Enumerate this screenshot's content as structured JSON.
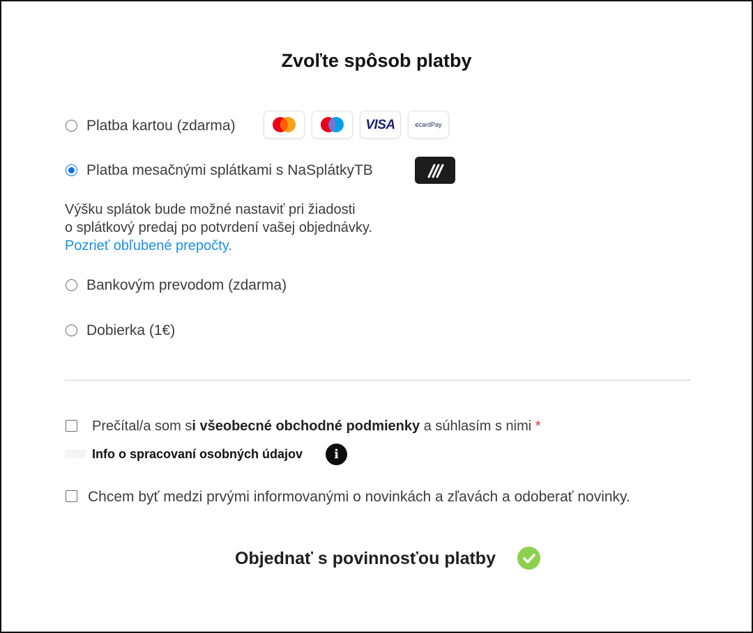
{
  "title": "Zvoľte spôsob platby",
  "payment_options": [
    {
      "label": "Platba kartou (zdarma)",
      "selected": false
    },
    {
      "label": "Platba mesačnými splátkami s NaSplátkyTB",
      "selected": true
    },
    {
      "label": "Bankovým prevodom (zdarma)",
      "selected": false
    },
    {
      "label": "Dobierka (1€)",
      "selected": false
    }
  ],
  "card_logos": {
    "mastercard": "mastercard-logo",
    "maestro": "maestro-logo",
    "visa": "VISA",
    "cardpay": "cardPay"
  },
  "installments": {
    "description_line1": "Výšku splátok bude možné nastaviť pri žiadosti",
    "description_line2": "o splátkový predaj po potvrdení vašej objednávky.",
    "link": "Pozrieť obľubené prepočty."
  },
  "consents": {
    "terms_prefix": "Prečítal/a som s",
    "terms_bold": "i všeobecné obchodné podmienky",
    "terms_suffix": " a súhlasím s nimi ",
    "terms_required": "*",
    "gdpr_info": "Info o spracovaní osobných údajov",
    "info_icon_glyph": "i",
    "newsletter": "Chcem byť medzi prvými informovanými o novinkách a zľavách a odoberať novinky."
  },
  "submit": {
    "label": "Objednať s povinnosťou platby",
    "icon": "check-circle-icon"
  },
  "colors": {
    "accent": "#0b73e8",
    "link": "#1a8fe3",
    "required": "#e0312f",
    "success": "#8fcf4f"
  }
}
